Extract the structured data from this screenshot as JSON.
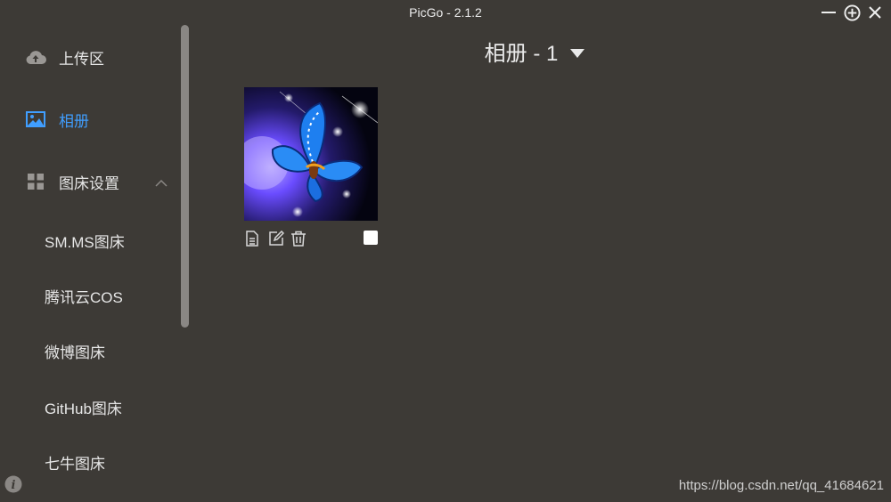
{
  "window": {
    "title": "PicGo - 2.1.2"
  },
  "sidebar": {
    "items": [
      {
        "label": "上传区",
        "icon": "upload-cloud-icon"
      },
      {
        "label": "相册",
        "icon": "image-icon",
        "active": true
      },
      {
        "label": "图床设置",
        "icon": "grid-icon",
        "expanded": true
      }
    ],
    "sub_items": [
      {
        "label": "SM.MS图床"
      },
      {
        "label": "腾讯云COS"
      },
      {
        "label": "微博图床"
      },
      {
        "label": "GitHub图床"
      },
      {
        "label": "七牛图床"
      }
    ]
  },
  "main": {
    "title": "相册 - 1",
    "images": [
      {
        "subject": "blue butterfly",
        "selected": false
      }
    ]
  },
  "footer": {
    "watermark": "https://blog.csdn.net/qq_41684621"
  },
  "colors": {
    "background": "#3d3a36",
    "accent": "#409eff",
    "text": "#e6e6e6"
  }
}
